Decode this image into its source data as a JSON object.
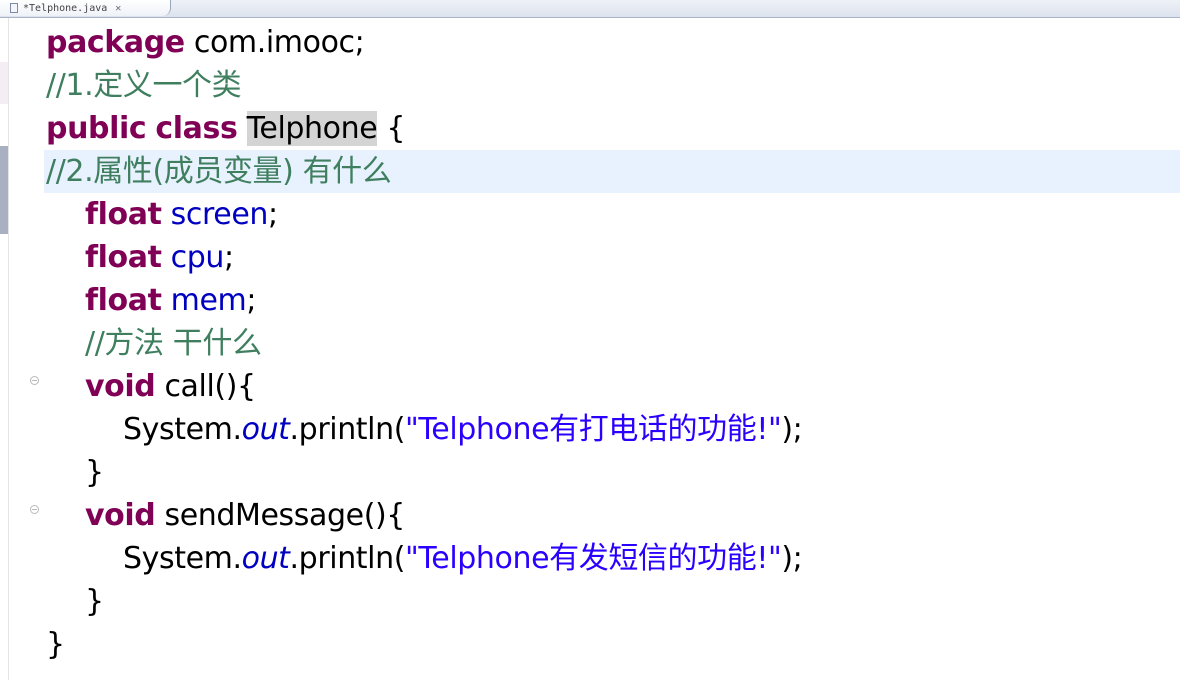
{
  "tab": {
    "title": "*Telphone.java",
    "close": "✕"
  },
  "code": {
    "package_kw": "package",
    "package_name": " com.imooc;",
    "c1": "//1.定义一个类",
    "public_kw": "public",
    "class_kw": "class",
    "class_name": "Telphone",
    "open_brace": " {",
    "c2": "//2.属性(成员变量) 有什么",
    "float_kw": "float",
    "f1": "screen",
    "f2": "cpu",
    "f3": "mem",
    "semi": ";",
    "c3": "//方法 干什么",
    "void_kw": "void",
    "m1": " call(){",
    "system": "System.",
    "out": "out",
    "println": ".println(",
    "s1": "\"Telphone有打电话的功能!\"",
    "end_call": ");",
    "close_brace": "}",
    "m2": " sendMessage(){",
    "s2": "\"Telphone有发短信的功能!\""
  },
  "colors": {
    "keyword": "#7f0055",
    "comment": "#3f7f5f",
    "string": "#2a00ff",
    "field": "#0000c0",
    "current_line": "#e8f2fe"
  },
  "icons": [
    "java-file-icon",
    "close-icon",
    "fold-collapse-icon"
  ]
}
